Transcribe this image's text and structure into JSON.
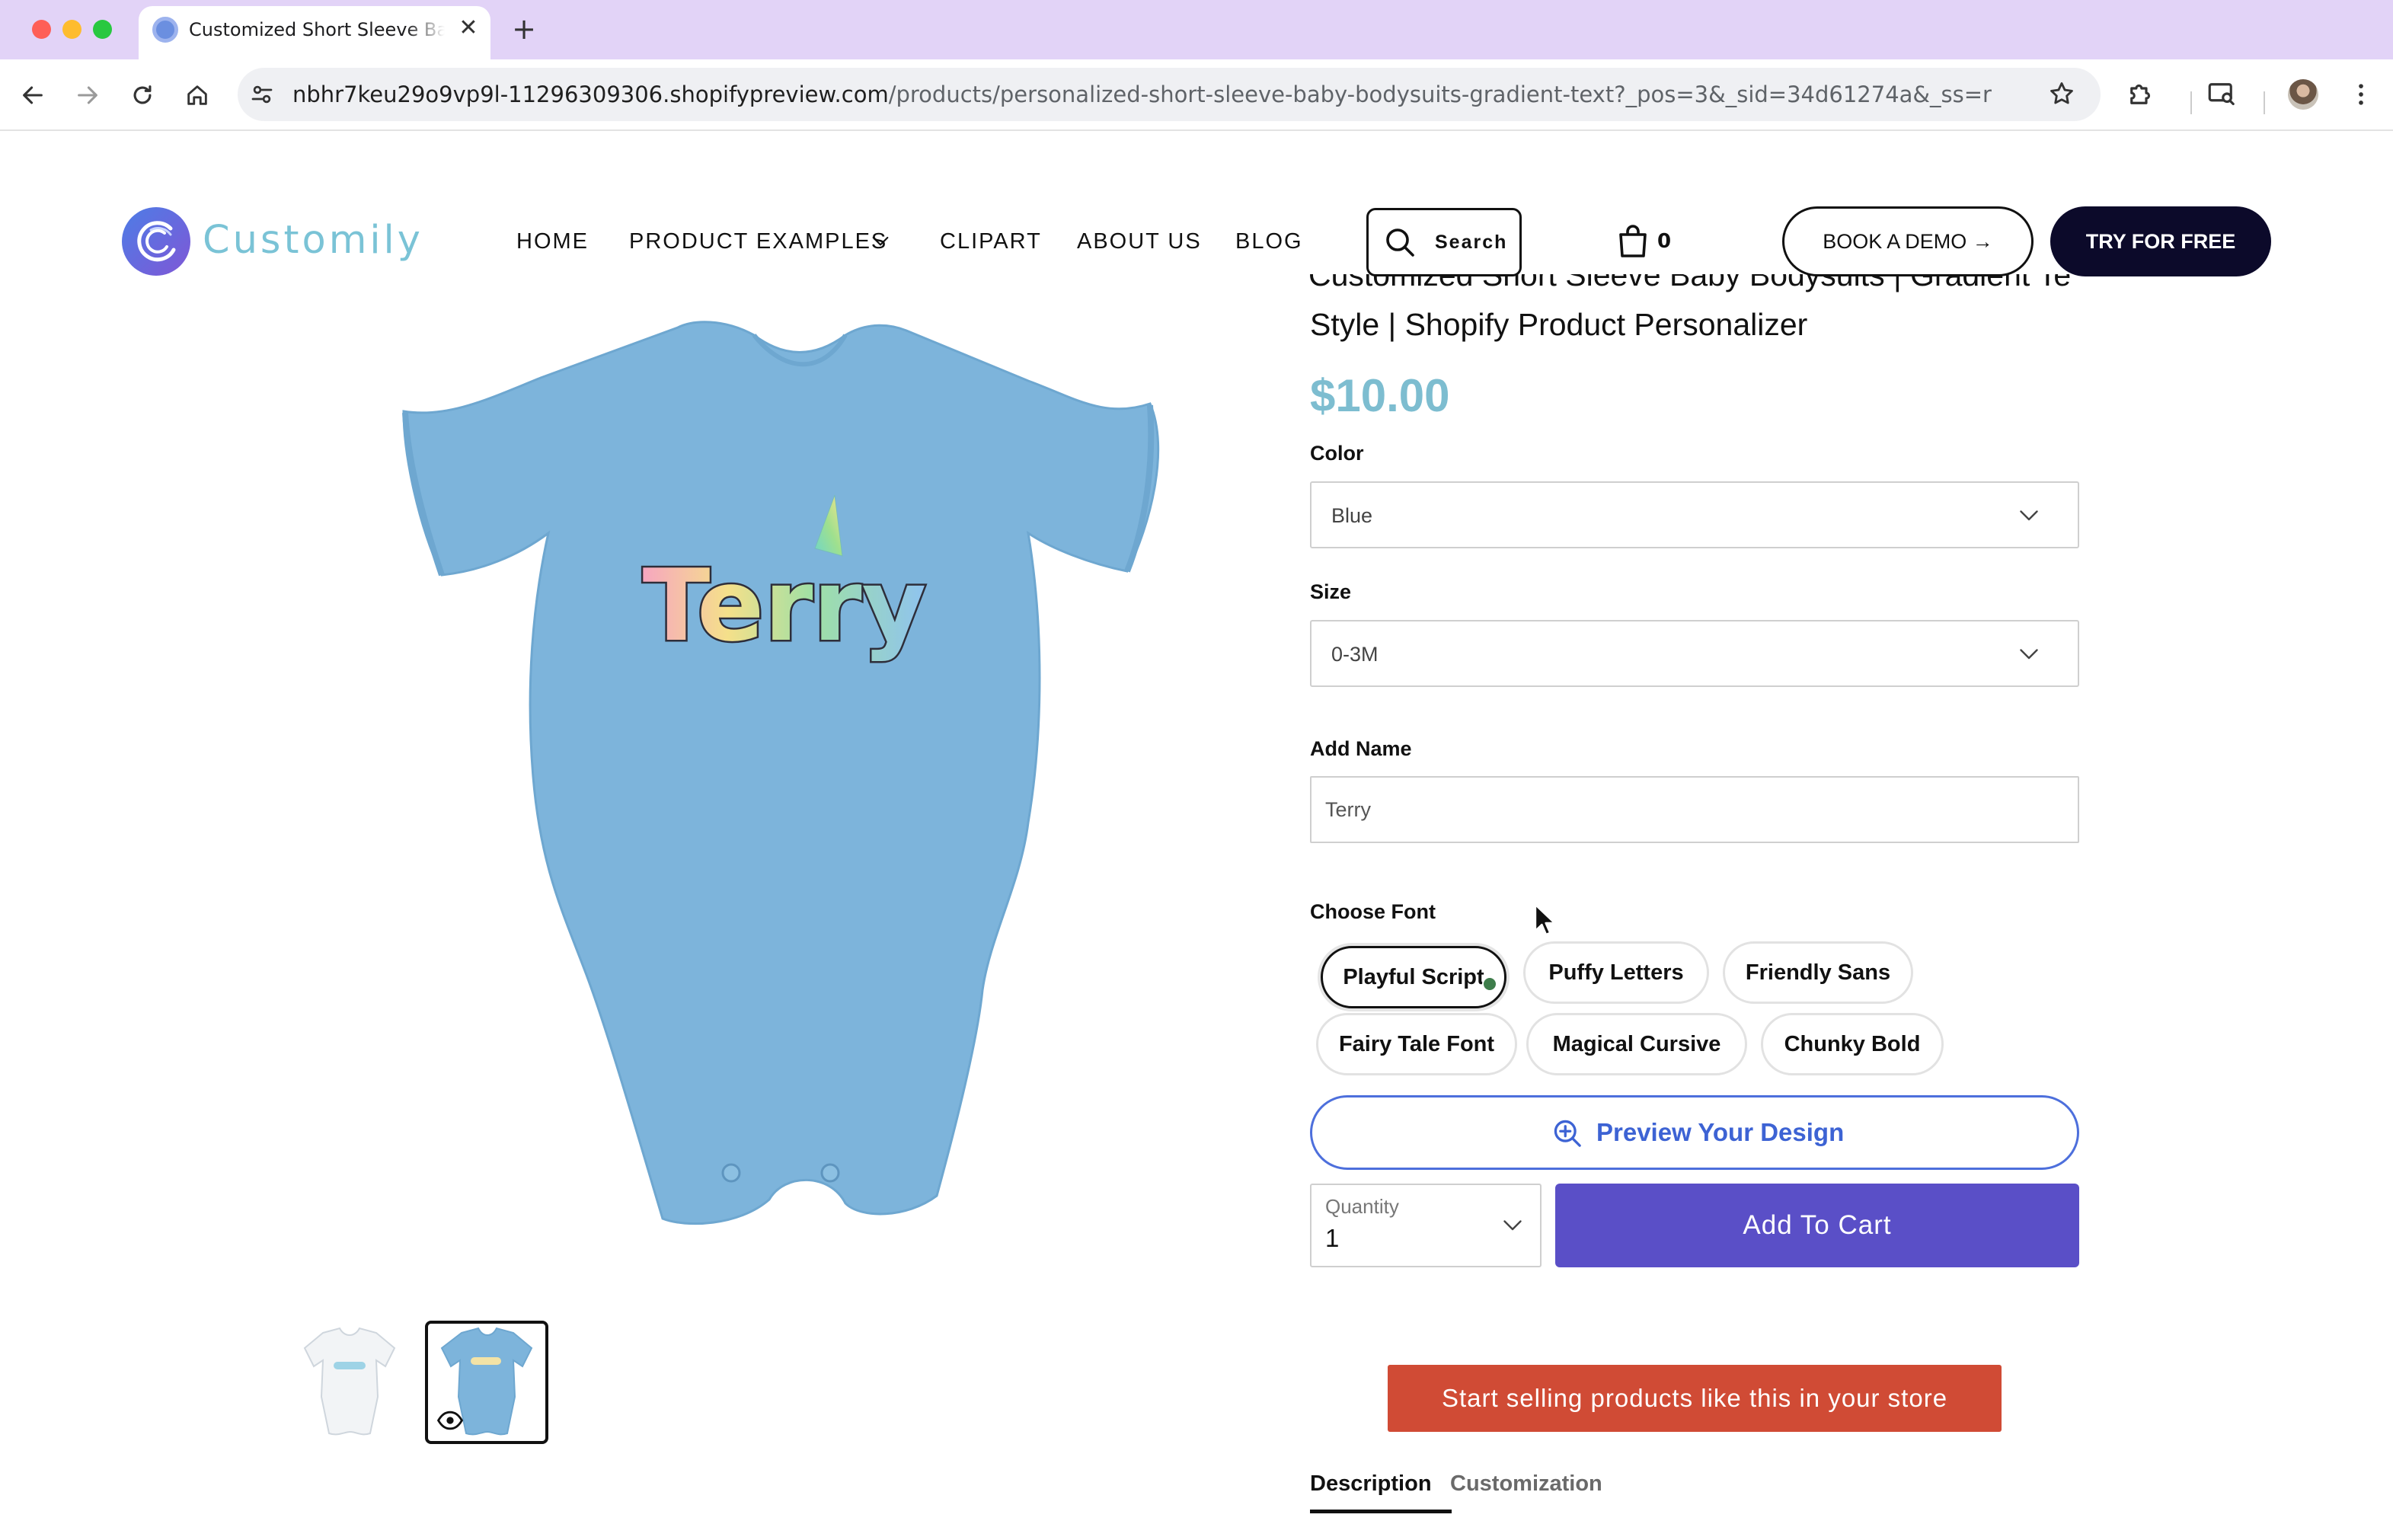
{
  "browser": {
    "tab_title": "Customized Short Sleeve Baby",
    "tab_close": "✕",
    "new_tab": "+",
    "url_domain": "nbhr7keu29o9vp9l-11296309306.shopifypreview.com",
    "url_path": "/products/personalized-short-sleeve-baby-bodysuits-gradient-text?_pos=3&_sid=34d61274a&_ss=r"
  },
  "header": {
    "logo_text": "Customily",
    "nav": [
      "HOME",
      "PRODUCT EXAMPLES",
      "CLIPART",
      "ABOUT US",
      "BLOG"
    ],
    "search_label": "Search",
    "cart_count": "0",
    "demo_button": "BOOK A DEMO →",
    "try_button": "TRY FOR FREE"
  },
  "product": {
    "title_line_partial": "Customized Short Sleeve Baby Bodysuits | Gradient Text",
    "title_line": "Style | Shopify Product Personalizer",
    "price": "$10.00",
    "image_text": "Terry",
    "color_label": "Color",
    "color_value": "Blue",
    "size_label": "Size",
    "size_value": "0-3M",
    "name_label": "Add Name",
    "name_value": "Terry",
    "font_label": "Choose Font",
    "fonts": [
      "Playful Script",
      "Puffy Letters",
      "Friendly Sans",
      "Fairy Tale Font",
      "Magical Cursive",
      "Chunky Bold"
    ],
    "selected_font": "Playful Script",
    "preview_label": "Preview Your Design",
    "quantity_label": "Quantity",
    "quantity_value": "1",
    "add_to_cart": "Add To Cart",
    "sell_banner": "Start selling products like this in your store",
    "tabs": [
      "Description",
      "Customization"
    ],
    "active_tab": "Description"
  },
  "colors": {
    "price": "#7dbdd0",
    "add_to_cart": "#5a4fc7",
    "banner": "#d04b35",
    "try_button": "#0c0a2a",
    "preview_accent": "#3d63d4",
    "bodysuit": "#7db4db",
    "tab_bar": "#e2d3f7"
  },
  "icons": {
    "back": "arrow-left-icon",
    "forward": "arrow-right-icon",
    "reload": "reload-icon",
    "home": "home-icon",
    "site_info": "tune-icon",
    "bookmark": "star-icon",
    "extensions": "puzzle-icon",
    "search": "search-icon",
    "cart": "shopping-bag-icon",
    "preview": "zoom-in-icon",
    "dropdown": "chevron-down-icon"
  }
}
